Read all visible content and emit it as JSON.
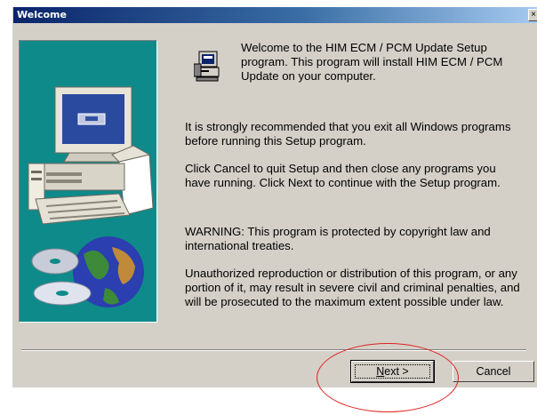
{
  "window": {
    "title": "Welcome",
    "close_glyph": "×"
  },
  "icons": {
    "setup": "setup-computer-icon",
    "close": "close-icon"
  },
  "content": {
    "paragraph1": "Welcome to the HIM ECM / PCM Update Setup\nprogram.  This program will install HIM ECM / PCM\nUpdate on your computer.",
    "paragraph2": "It is strongly recommended that you exit all Windows programs\nbefore running this Setup program.",
    "paragraph3": "Click Cancel to quit Setup and then close any programs you\nhave running.  Click Next to continue with the Setup program.",
    "paragraph4": "WARNING: This program is protected by copyright law and\ninternational treaties.",
    "paragraph5": "Unauthorized reproduction or distribution of this program, or any\nportion of it, may result in severe civil and criminal penalties, and\nwill be prosecuted to the maximum extent possible under law."
  },
  "buttons": {
    "next_mnemonic": "N",
    "next_rest": "ext >",
    "cancel": "Cancel"
  },
  "colors": {
    "titlebar": "#0a246a",
    "art_bg": "#0f8a8a",
    "annotation": "#e02020",
    "face": "#d4d0c8"
  }
}
